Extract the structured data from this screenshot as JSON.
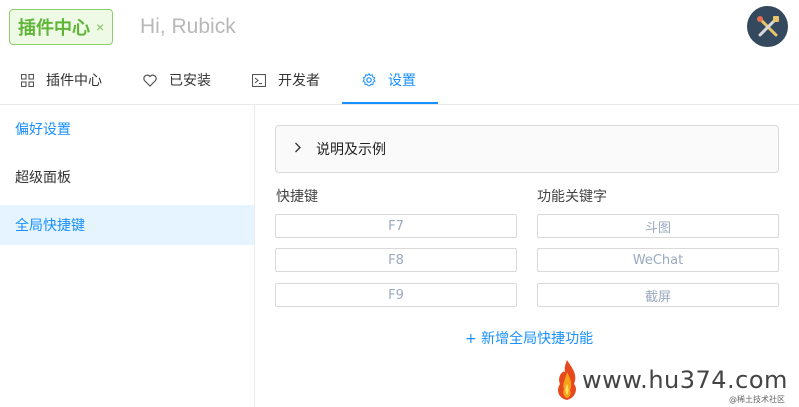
{
  "header": {
    "plugin_tag": "插件中心",
    "plugin_tag_close": "×",
    "search_placeholder": "Hi, Rubick",
    "avatar_icon": "tools-icon"
  },
  "tabs": [
    {
      "label": "插件中心",
      "icon": "grid-icon"
    },
    {
      "label": "已安装",
      "icon": "heart-icon"
    },
    {
      "label": "开发者",
      "icon": "terminal-icon"
    },
    {
      "label": "设置",
      "icon": "gear-icon",
      "active": true
    }
  ],
  "sidebar": {
    "items": [
      {
        "label": "偏好设置"
      },
      {
        "label": "超级面板"
      },
      {
        "label": "全局快捷键",
        "selected": true
      }
    ]
  },
  "main": {
    "collapse_label": "说明及示例",
    "shortcut_header": "快捷键",
    "keyword_header": "功能关键字",
    "rows": [
      {
        "shortcut": "F7",
        "keyword": "斗图"
      },
      {
        "shortcut": "F8",
        "keyword": "WeChat"
      },
      {
        "shortcut": "F9",
        "keyword": "截屏"
      }
    ],
    "add_label": "+ 新增全局快捷功能"
  },
  "watermark": {
    "text": "www.hu374.com",
    "sub": "@稀土技术社区"
  },
  "colors": {
    "accent": "#1890ff",
    "tag_green": "#5fb536",
    "avatar_bg": "#34495e"
  }
}
